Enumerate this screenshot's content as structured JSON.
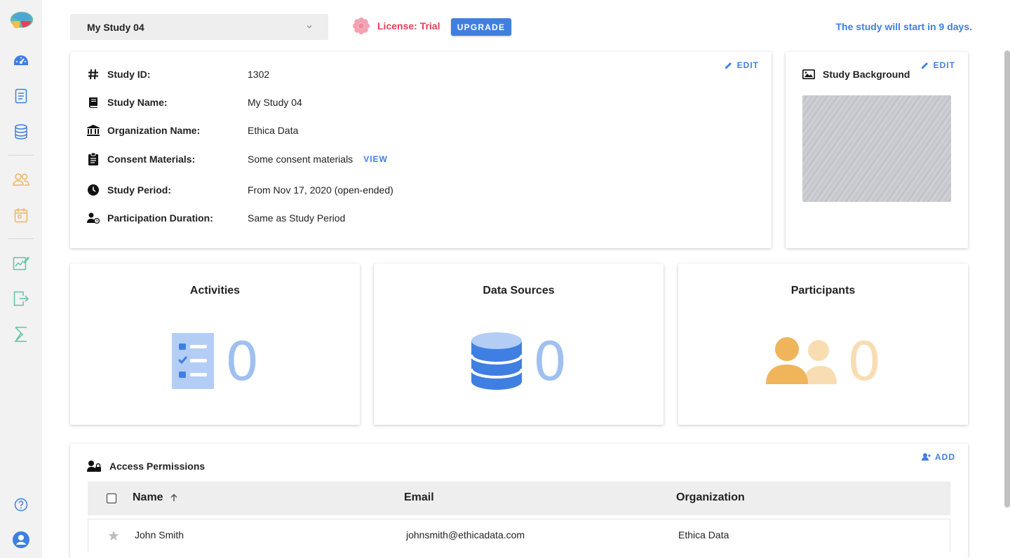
{
  "study_selector": {
    "value": "My Study 04"
  },
  "license": {
    "text": "License: Trial",
    "upgrade_label": "UPGRADE"
  },
  "study_start_message": "The study will start in 9 days.",
  "study_info": {
    "edit_label": "EDIT",
    "rows": [
      {
        "label": "Study ID:",
        "value": "1302",
        "icon": "hash-icon"
      },
      {
        "label": "Study Name:",
        "value": "My Study 04",
        "icon": "book-icon"
      },
      {
        "label": "Organization Name:",
        "value": "Ethica Data",
        "icon": "institution-icon"
      },
      {
        "label": "Consent Materials:",
        "value": "Some consent materials",
        "icon": "clipboard-icon",
        "link": "VIEW"
      },
      {
        "label": "Study Period:",
        "value": "From Nov 17, 2020 (open-ended)",
        "icon": "clock-icon"
      },
      {
        "label": "Participation Duration:",
        "value": "Same as Study Period",
        "icon": "user-clock-icon"
      }
    ]
  },
  "study_background": {
    "title": "Study Background",
    "edit_label": "EDIT"
  },
  "stats": {
    "activities": {
      "title": "Activities",
      "count": "0",
      "color": "#9fc0f0"
    },
    "data_sources": {
      "title": "Data Sources",
      "count": "0",
      "color": "#9fc0f0"
    },
    "participants": {
      "title": "Participants",
      "count": "0",
      "color": "#f8ddb3"
    }
  },
  "access_permissions": {
    "title": "Access Permissions",
    "add_label": "ADD",
    "columns": [
      "Name",
      "Email",
      "Organization"
    ],
    "rows": [
      {
        "name": "John Smith",
        "email": "johnsmith@ethicadata.com",
        "organization": "Ethica Data"
      }
    ]
  },
  "colors": {
    "accent": "#3f7fe2",
    "license": "#e8405b",
    "orange": "#f0b45a"
  }
}
